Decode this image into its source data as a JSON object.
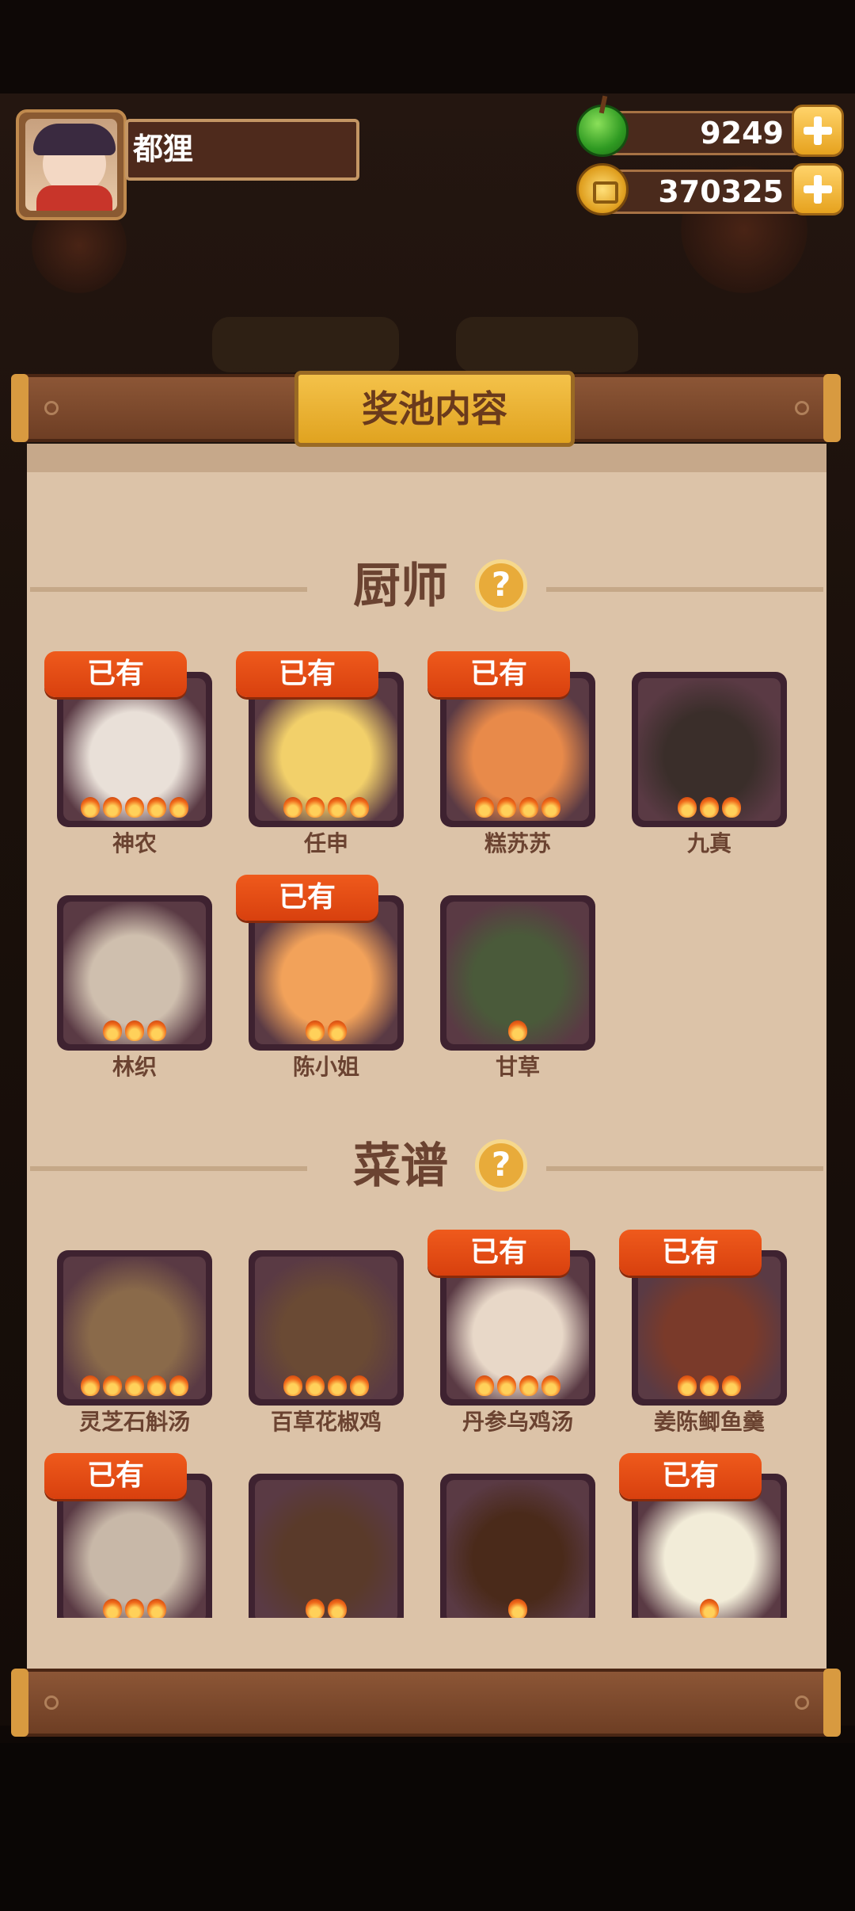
{
  "player": {
    "name": "都狸"
  },
  "resources": {
    "gems": {
      "value": "9249",
      "icon": "green-apple-icon"
    },
    "coins": {
      "value": "370325",
      "icon": "gold-coin-icon"
    }
  },
  "panel": {
    "title": "奖池内容"
  },
  "owned_label": "已有",
  "sections": {
    "chefs": {
      "title": "厨师",
      "items": [
        {
          "name": "神农",
          "stars": 5,
          "owned": true
        },
        {
          "name": "任申",
          "stars": 4,
          "owned": true
        },
        {
          "name": "糕苏苏",
          "stars": 4,
          "owned": true
        },
        {
          "name": "九真",
          "stars": 3,
          "owned": false
        },
        {
          "name": "林织",
          "stars": 3,
          "owned": false
        },
        {
          "name": "陈小姐",
          "stars": 2,
          "owned": true
        },
        {
          "name": "甘草",
          "stars": 1,
          "owned": false
        }
      ]
    },
    "recipes": {
      "title": "菜谱",
      "items": [
        {
          "name": "灵芝石斛汤",
          "stars": 5,
          "owned": false
        },
        {
          "name": "百草花椒鸡",
          "stars": 4,
          "owned": false
        },
        {
          "name": "丹参乌鸡汤",
          "stars": 4,
          "owned": true
        },
        {
          "name": "姜陈鲫鱼羹",
          "stars": 3,
          "owned": true
        },
        {
          "name": "",
          "stars": 3,
          "owned": true
        },
        {
          "name": "",
          "stars": 2,
          "owned": false
        },
        {
          "name": "",
          "stars": 1,
          "owned": false
        },
        {
          "name": "",
          "stars": 1,
          "owned": true
        }
      ]
    }
  },
  "colors": {
    "accent": "#e0a320",
    "owned_badge": "#e4501a",
    "paper": "#dcc3a8",
    "card": "#3e2230"
  }
}
